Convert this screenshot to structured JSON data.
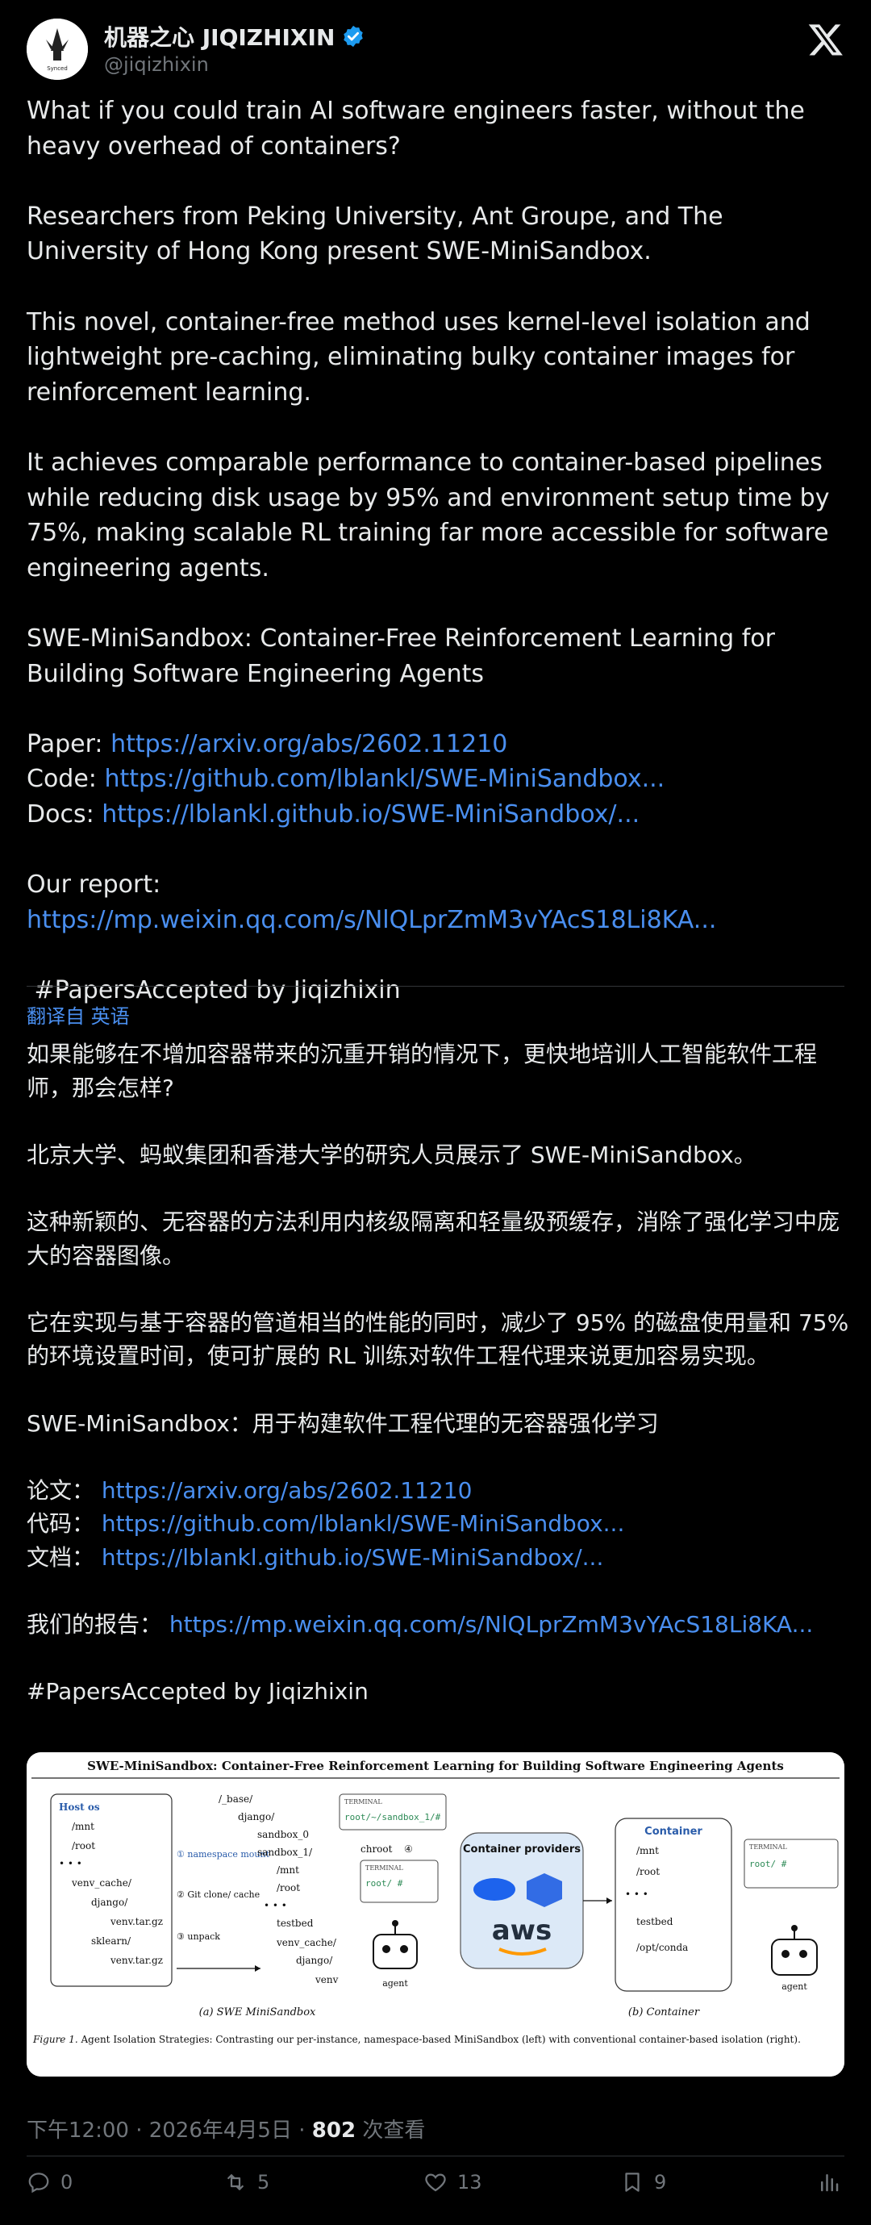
{
  "author": {
    "name": "机器之心 JIQIZHIXIN",
    "handle": "@jiqizhixin",
    "avatar_caption": "Synced"
  },
  "post": {
    "p1": "What if you could train AI software engineers faster, without the heavy overhead of containers?",
    "p2": "Researchers from Peking University, Ant Groupe, and The University of Hong Kong present SWE-MiniSandbox.",
    "p3": "This novel, container-free method uses kernel-level isolation and lightweight pre-caching, eliminating bulky container images for reinforcement learning.",
    "p4": "It achieves comparable performance to container-based pipelines while reducing disk usage by 95% and environment setup time by 75%, making scalable RL training far more accessible for software engineering agents.",
    "p5": "SWE-MiniSandbox: Container-Free Reinforcement Learning for Building Software Engineering Agents",
    "paper_label": "Paper: ",
    "paper_link": "https://arxiv.org/abs/2602.11210",
    "code_label": "Code: ",
    "code_link": "https://github.com/lblankl/SWE-MiniSandbox...",
    "docs_label": "Docs: ",
    "docs_link": "https://lblankl.github.io/SWE-MiniSandbox/...",
    "report_label": "Our report: ",
    "report_link": "https://mp.weixin.qq.com/s/NlQLprZmM3vYAcS18Li8KA...",
    "hashtag": " #PapersAccepted by Jiqizhixin"
  },
  "translation": {
    "label": "翻译自 英语",
    "p1": "如果能够在不增加容器带来的沉重开销的情况下，更快地培训人工智能软件工程师，那会怎样?",
    "p2": "北京大学、蚂蚁集团和香港大学的研究人员展示了 SWE-MiniSandbox。",
    "p3": "这种新颖的、无容器的方法利用内核级隔离和轻量级预缓存，消除了强化学习中庞大的容器图像。",
    "p4": "它在实现与基于容器的管道相当的性能的同时，减少了 95% 的磁盘使用量和 75% 的环境设置时间，使可扩展的 RL 训练对软件工程代理来说更加容易实现。",
    "p5": "SWE-MiniSandbox：用于构建软件工程代理的无容器强化学习",
    "paper_label": "论文： ",
    "paper_link": "https://arxiv.org/abs/2602.11210",
    "code_label": "代码： ",
    "code_link": "https://github.com/lblankl/SWE-MiniSandbox...",
    "docs_label": "文档： ",
    "docs_link": "https://lblankl.github.io/SWE-MiniSandbox/...",
    "report_label": "我们的报告： ",
    "report_link": "https://mp.weixin.qq.com/s/NlQLprZmM3vYAcS18Li8KA...",
    "hashtag": "#PapersAccepted by Jiqizhixin"
  },
  "figure": {
    "title": "SWE-MiniSandbox: Container-Free Reinforcement Learning for Building Software Engineering Agents",
    "host_os": "Host os",
    "mnt": "/mnt",
    "root": "/root",
    "dots": "• • •",
    "venv_cache": "venv_cache/",
    "django": "django/",
    "venv_tar": "venv.tar.gz",
    "sklearn": "sklearn/",
    "base": "/_base/",
    "sandbox_0": "sandbox_0",
    "sandbox_1": "sandbox_1/",
    "testbed": "testbed",
    "venv": "venv",
    "step1": "① namespace mount",
    "step2": "② Git clone/ cache",
    "step3": "③ unpack",
    "step4": "④",
    "chroot": "chroot",
    "terminal": "TERMINAL",
    "prompt_sandbox": "root/~/sandbox_1/#",
    "prompt_root": "root/ #",
    "agent": "agent",
    "providers": "Container providers",
    "aws": "aws",
    "container": "Container",
    "opt_conda": "/opt/conda",
    "caption_a": "(a) SWE MiniSandbox",
    "caption_b": "(b) Container",
    "figure_label": "Figure 1.",
    "figure_caption": " Agent Isolation Strategies: Contrasting our per-instance, namespace-based MiniSandbox (left) with conventional container-based isolation (right)."
  },
  "meta": {
    "time": "下午12:00 · 2026年4月5日 · ",
    "views": "802",
    "views_label": " 次查看"
  },
  "actions": {
    "replies": "0",
    "reposts": "5",
    "likes": "13",
    "bookmarks": "9"
  }
}
